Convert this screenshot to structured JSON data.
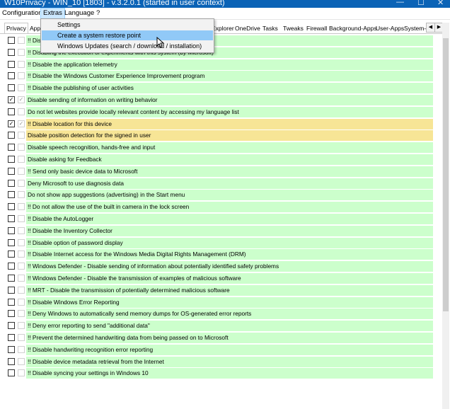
{
  "window": {
    "title": "W10Privacy - WIN_10 [1803] - v.3.2.0.1 (started in user context)"
  },
  "menu": [
    {
      "label": "Configuration"
    },
    {
      "label": "Extras"
    },
    {
      "label": "Language"
    },
    {
      "label": "?"
    }
  ],
  "tabs": [
    "Privacy",
    "Apps",
    "Explorer",
    "OneDrive",
    "Tasks",
    "Tweaks",
    "Firewall",
    "Background-Apps",
    "User-Apps",
    "System-A"
  ],
  "extras_menu": {
    "items": [
      "Settings",
      "Create a system restore point",
      "Windows Updates (search / download / installation)"
    ]
  },
  "colors": {
    "row_green": "#ccffcc",
    "row_yellow": "#f7e596",
    "highlight": "#91c9f7"
  },
  "settings": [
    {
      "label": "!! Disa",
      "checked": false,
      "color": "green"
    },
    {
      "label": "!! Disabling the execution of experiments with this system (by Microsoft)",
      "checked": false,
      "color": "green"
    },
    {
      "label": "!! Disable the application telemetry",
      "checked": false,
      "color": "green"
    },
    {
      "label": "!! Disable the Windows Customer Experience Improvement program",
      "checked": false,
      "color": "green"
    },
    {
      "label": "!! Disable the publishing of user activities",
      "checked": false,
      "color": "green"
    },
    {
      "label": "Disable sending of information on writing behavior",
      "checked": true,
      "color": "green"
    },
    {
      "label": "Do not let websites provide locally relevant content by accessing my language list",
      "checked": false,
      "color": "green"
    },
    {
      "label": "!! Disable location for this device",
      "checked": true,
      "color": "yellow"
    },
    {
      "label": "Disable position detection for the signed in user",
      "checked": false,
      "color": "yellow"
    },
    {
      "label": "Disable speech recognition, hands-free and input",
      "checked": false,
      "color": "green"
    },
    {
      "label": "Disable asking for Feedback",
      "checked": false,
      "color": "green"
    },
    {
      "label": "!! Send only basic device data to Microsoft",
      "checked": false,
      "color": "green"
    },
    {
      "label": "Deny Microsoft to use diagnosis data",
      "checked": false,
      "color": "green"
    },
    {
      "label": "Do not show app suggestions (advertising) in the Start menu",
      "checked": false,
      "color": "green"
    },
    {
      "label": "!! Do not allow the use of the built in camera in the lock screen",
      "checked": false,
      "color": "green"
    },
    {
      "label": "!! Disable the AutoLogger",
      "checked": false,
      "color": "green"
    },
    {
      "label": "!! Disable the Inventory Collector",
      "checked": false,
      "color": "green"
    },
    {
      "label": "!! Disable option of password display",
      "checked": false,
      "color": "green"
    },
    {
      "label": "!! Disable Internet access for the Windows Media Digital Rights Management (DRM)",
      "checked": false,
      "color": "green"
    },
    {
      "label": "!! Windows Defender - Disable sending of information about potentially identified safety problems",
      "checked": false,
      "color": "green"
    },
    {
      "label": "!! Windows Defender - Disable the transmission of examples of malicious software",
      "checked": false,
      "color": "green"
    },
    {
      "label": "!! MRT - Disable the transmission of potentially determined malicious software",
      "checked": false,
      "color": "green"
    },
    {
      "label": "!! Disable Windows Error Reporting",
      "checked": false,
      "color": "green"
    },
    {
      "label": "!! Deny Windows to automatically send memory dumps for OS-generated error reports",
      "checked": false,
      "color": "green"
    },
    {
      "label": "!! Deny error reporting to send \"additional data\"",
      "checked": false,
      "color": "green"
    },
    {
      "label": "!! Prevent the determined handwriting data from being passed on to Microsoft",
      "checked": false,
      "color": "green"
    },
    {
      "label": "!! Disable handwriting recognition error reporting",
      "checked": false,
      "color": "green"
    },
    {
      "label": "!! Disable device metadata retrieval from the Internet",
      "checked": false,
      "color": "green"
    },
    {
      "label": "!! Disable syncing your settings in Windows 10",
      "checked": false,
      "color": "green"
    }
  ]
}
